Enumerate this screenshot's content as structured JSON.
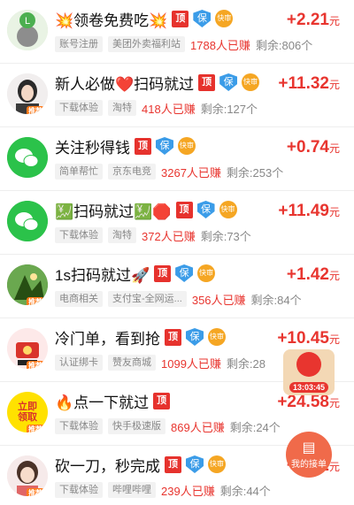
{
  "tasks": [
    {
      "title": "💥领卷免费吃💥",
      "badges": [
        "顶",
        "保",
        "快审"
      ],
      "price": "+2.21",
      "unit": "元",
      "tags": [
        "账号注册",
        "美团外卖福利站"
      ],
      "earned": "1788人已赚",
      "remaining": "剩余:806个",
      "avatar": "green-l"
    },
    {
      "title": "新人必做❤️扫码就过",
      "badges": [
        "顶",
        "保",
        "快审"
      ],
      "price": "+11.32",
      "unit": "元",
      "tags": [
        "下载体验",
        "淘特"
      ],
      "earned": "418人已赚",
      "remaining": "剩余:127个",
      "avatar": "girl"
    },
    {
      "title": "关注秒得钱",
      "badges": [
        "顶",
        "保",
        "快审"
      ],
      "price": "+0.74",
      "unit": "元",
      "tags": [
        "简单帮忙",
        "京东电竞"
      ],
      "earned": "3267人已赚",
      "remaining": "剩余:253个",
      "avatar": "wechat"
    },
    {
      "title": "💹扫码就过💹🛑",
      "badges": [
        "顶",
        "保",
        "快审"
      ],
      "price": "+11.49",
      "unit": "元",
      "tags": [
        "下载体验",
        "淘特"
      ],
      "earned": "372人已赚",
      "remaining": "剩余:73个",
      "avatar": "wechat"
    },
    {
      "title": "1s扫码就过🚀",
      "badges": [
        "顶",
        "保",
        "快审"
      ],
      "price": "+1.42",
      "unit": "元",
      "tags": [
        "电商相关",
        "支付宝-全网运..."
      ],
      "earned": "356人已赚",
      "remaining": "剩余:84个",
      "avatar": "game"
    },
    {
      "title": "冷门单，看到抢",
      "badges": [
        "顶",
        "保",
        "快审"
      ],
      "price": "+10.45",
      "unit": "元",
      "tags": [
        "认证绑卡",
        "赞友商城"
      ],
      "earned": "1099人已赚",
      "remaining": "剩余:28",
      "avatar": "red"
    },
    {
      "title": "🔥点一下就过",
      "badges": [
        "顶"
      ],
      "price": "+24.58",
      "unit": "元",
      "tags": [
        "下载体验",
        "快手极速版"
      ],
      "earned": "869人已赚",
      "remaining": "剩余:24个",
      "avatar": "yellow"
    },
    {
      "title": "砍一刀，秒完成",
      "badges": [
        "顶",
        "保",
        "快审"
      ],
      "price": "+1.42",
      "unit": "元",
      "tags": [
        "下载体验",
        "哔哩哔哩"
      ],
      "earned": "239人已赚",
      "remaining": "剩余:44个",
      "avatar": "girl2"
    }
  ],
  "avatar_tags": {
    "yellow_top": "立即",
    "yellow_bottom": "领取",
    "corner": "推荐"
  },
  "coupon_float": {
    "timer": "13:03:45"
  },
  "my_orders": {
    "label": "我的接单",
    "icon": "document-icon"
  },
  "colors": {
    "accent_red": "#e8352f",
    "badge_blue": "#3b9ce8",
    "badge_orange": "#f5a623",
    "wechat_green": "#2bc24a"
  }
}
